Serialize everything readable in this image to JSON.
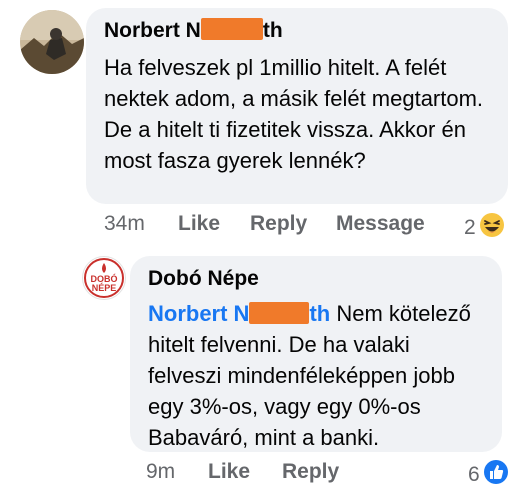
{
  "comments": [
    {
      "author": "Norbert N",
      "author_suffix": "th",
      "text": "Ha felveszek pl 1millio hitelt. A felét nektek adom, a másik felét megtartom. De a hitelt ti fizetitek vissza. Akkor én most fasza gyerek lennék?",
      "time": "34m",
      "actions": [
        "Like",
        "Reply",
        "Message"
      ],
      "reaction_count": "2",
      "reaction_icon": "haha-emoji-icon"
    },
    {
      "author": "Dobó Népe",
      "avatar_text": "DOBÓ NÉPE",
      "mention": "Norbert N",
      "mention_suffix": "th",
      "text": "Nem kötelező hitelt felvenni. De ha valaki felveszi mindenféleképpen jobb egy 3%-os, vagy egy 0%-os Babaváró, mint a banki.",
      "time": "9m",
      "actions": [
        "Like",
        "Reply"
      ],
      "reaction_count": "6",
      "reaction_icon": "like-thumb-icon"
    }
  ],
  "colors": {
    "accent": "#1877f2",
    "redaction": "#f07a2a",
    "bubble": "#f0f2f5",
    "meta": "#65676b"
  }
}
